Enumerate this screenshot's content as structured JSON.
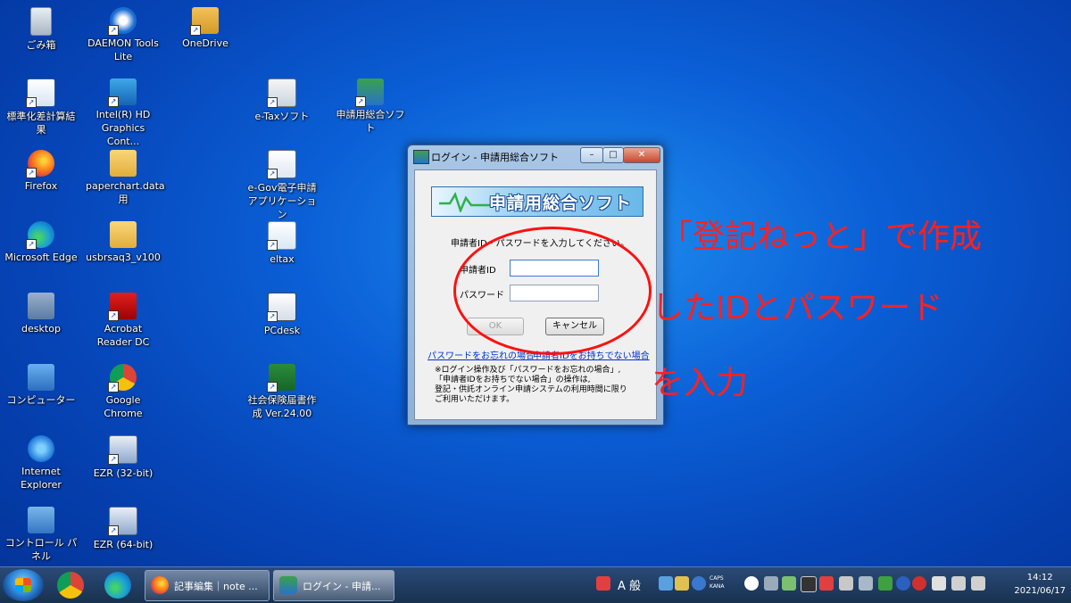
{
  "desktop": {
    "icons": [
      {
        "label": "ごみ箱"
      },
      {
        "label": "DAEMON Tools Lite"
      },
      {
        "label": "OneDrive"
      },
      {
        "label": "標準化差計算結果"
      },
      {
        "label": "Intel(R) HD Graphics Cont..."
      },
      {
        "label": "e-Taxソフト"
      },
      {
        "label": "申請用総合ソフト"
      },
      {
        "label": "Firefox"
      },
      {
        "label": "paperchart.data用"
      },
      {
        "label": "e-Gov電子申請アプリケーション"
      },
      {
        "label": "Microsoft Edge"
      },
      {
        "label": "usbrsaq3_v100"
      },
      {
        "label": "eltax"
      },
      {
        "label": "desktop"
      },
      {
        "label": "Acrobat Reader DC"
      },
      {
        "label": "PCdesk"
      },
      {
        "label": "コンピューター"
      },
      {
        "label": "Google Chrome"
      },
      {
        "label": "社会保険届書作成 Ver.24.00"
      },
      {
        "label": "Internet Explorer"
      },
      {
        "label": "EZR (32-bit)"
      },
      {
        "label": "コントロール パネル"
      },
      {
        "label": "EZR (64-bit)"
      }
    ]
  },
  "dialog": {
    "title": "ログイン - 申請用総合ソフト",
    "minimize": "–",
    "maximize": "□",
    "close": "✕",
    "banner_text": "申請用総合ソフト",
    "instruction": "申請者ID・パスワードを入力してください。",
    "id_label": "申請者ID",
    "id_value": "",
    "password_label": "パスワード",
    "password_value": "",
    "ok_label": "OK",
    "cancel_label": "キャンセル",
    "forgot_password_link": "パスワードをお忘れの場合",
    "no_id_link": "申請者IDをお持ちでない場合",
    "note_lines": [
      "※ログイン操作及び「パスワードをお忘れの場合」,",
      "「申請者IDをお持ちでない場合」の操作は,",
      "登記・供託オンライン申請システムの利用時間に限り",
      "ご利用いただけます。"
    ]
  },
  "annotation": {
    "line1": "「登記ねっと」で作成",
    "line2": "したIDとパスワード",
    "line3": "を入力",
    "color": "#ff2020"
  },
  "taskbar": {
    "tasks": [
      {
        "label": "記事編集｜note ..."
      },
      {
        "label": "ログイン - 申請..."
      }
    ],
    "ime_mode": "A 般",
    "caps": "CAPS",
    "kana": "KANA",
    "time": "14:12",
    "date": "2021/06/17"
  }
}
